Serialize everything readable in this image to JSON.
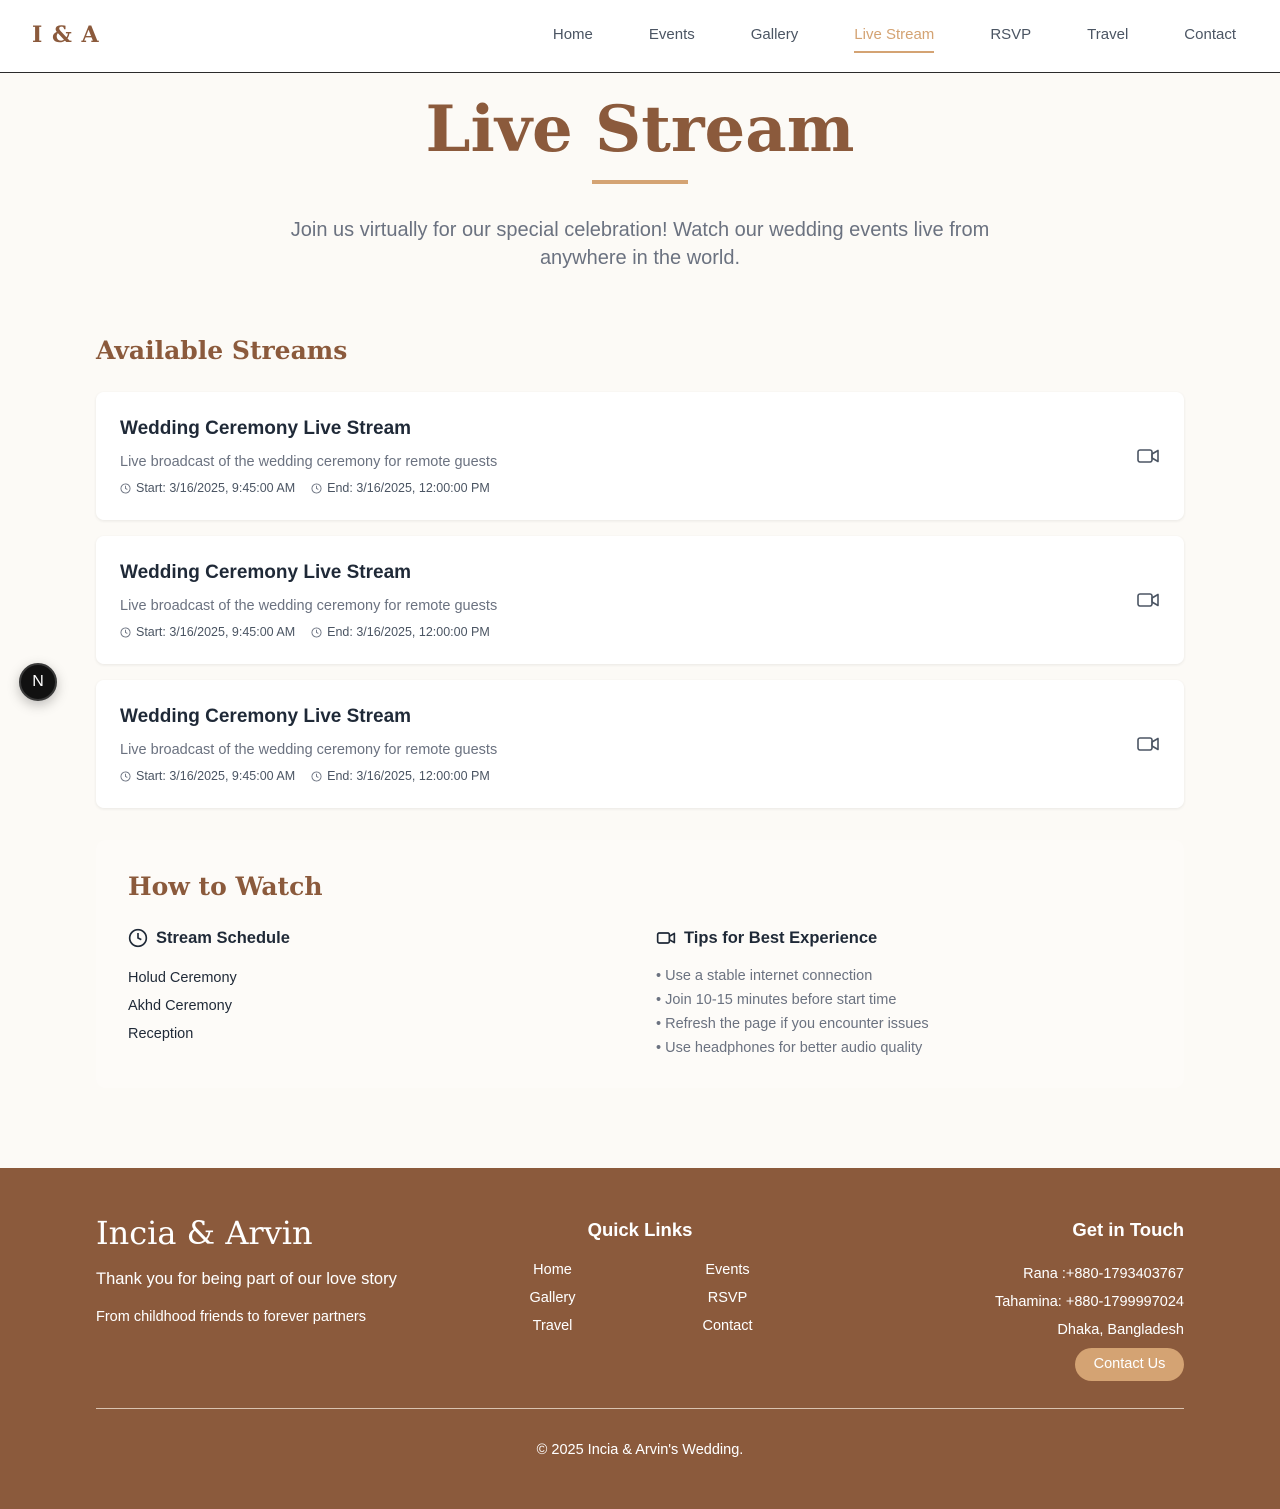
{
  "header": {
    "logo": "I & A",
    "nav": [
      {
        "label": "Home"
      },
      {
        "label": "Events"
      },
      {
        "label": "Gallery"
      },
      {
        "label": "Live Stream",
        "active": true
      },
      {
        "label": "RSVP"
      },
      {
        "label": "Travel"
      },
      {
        "label": "Contact"
      }
    ]
  },
  "hero": {
    "title": "Live Stream",
    "subtitle": "Join us virtually for our special celebration! Watch our wedding events live from anywhere in the world."
  },
  "streams": {
    "title": "Available Streams",
    "items": [
      {
        "title": "Wedding Ceremony Live Stream",
        "description": "Live broadcast of the wedding ceremony for remote guests",
        "start": "Start: 3/16/2025, 9:45:00 AM",
        "end": "End: 3/16/2025, 12:00:00 PM",
        "icon": "video-icon"
      },
      {
        "title": "Wedding Ceremony Live Stream",
        "description": "Live broadcast of the wedding ceremony for remote guests",
        "start": "Start: 3/16/2025, 9:45:00 AM",
        "end": "End: 3/16/2025, 12:00:00 PM",
        "icon": "video-icon"
      },
      {
        "title": "Wedding Ceremony Live Stream",
        "description": "Live broadcast of the wedding ceremony for remote guests",
        "start": "Start: 3/16/2025, 9:45:00 AM",
        "end": "End: 3/16/2025, 12:00:00 PM",
        "icon": "video-icon"
      }
    ]
  },
  "floating_badge": {
    "label": "N"
  },
  "how_to_watch": {
    "title": "How to Watch",
    "schedule": {
      "heading": "Stream Schedule",
      "items": [
        "Holud Ceremony",
        "Akhd Ceremony",
        "Reception"
      ]
    },
    "tips": {
      "heading": "Tips for Best Experience",
      "items": [
        "• Use a stable internet connection",
        "• Join 10-15 minutes before start time",
        "• Refresh the page if you encounter issues",
        "• Use headphones for better audio quality"
      ]
    }
  },
  "footer": {
    "brand": "Incia & Arvin",
    "tagline": "Thank you for being part of our love story",
    "subtagline": "From childhood friends to forever partners",
    "quick_links": {
      "title": "Quick Links",
      "links": [
        "Home",
        "Events",
        "Gallery",
        "RSVP",
        "Travel",
        "Contact"
      ]
    },
    "get_in_touch": {
      "title": "Get in Touch",
      "lines": [
        "Rana :+880-1793403767",
        "Tahamina: +880-1799997024",
        "Dhaka, Bangladesh"
      ],
      "button": "Contact Us"
    },
    "copyright": "© 2025 Incia & Arvin's Wedding."
  },
  "colors": {
    "brand_brown": "#8b5a3c",
    "accent_tan": "#d4a373",
    "page_bg": "#fcfaf6"
  }
}
